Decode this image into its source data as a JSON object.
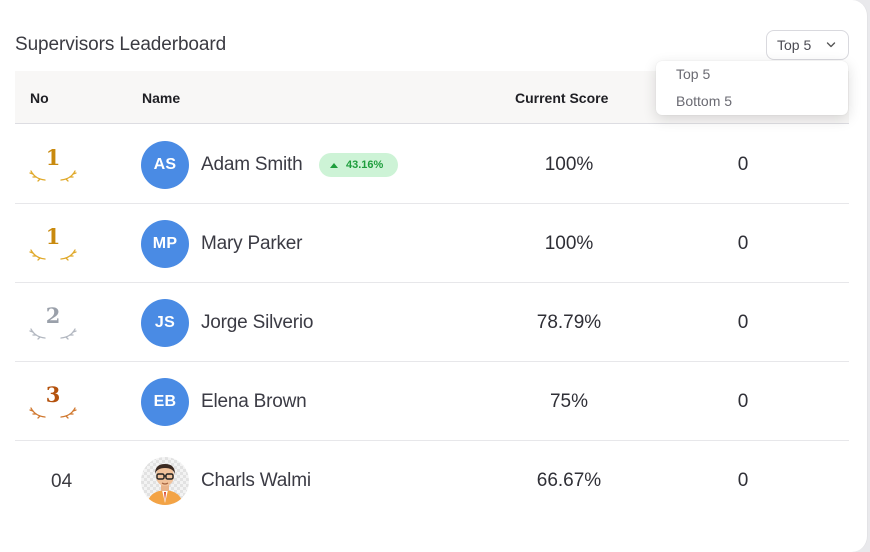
{
  "title": "Supervisors Leaderboard",
  "filter": {
    "selected": "Top 5",
    "options": [
      "Top 5",
      "Bottom 5"
    ]
  },
  "columns": {
    "no": "No",
    "name": "Name",
    "current_score": "Current Score"
  },
  "colors": {
    "gold": "#c98a0e",
    "silver": "#9aa0aa",
    "bronze": "#b4520d",
    "avatar": "#4a8be4",
    "badge_bg": "#cdf3d6",
    "badge_text": "#1f9e3d"
  },
  "rows": [
    {
      "rank": "1",
      "rank_style": "gold",
      "initials": "AS",
      "name": "Adam Smith",
      "badge": "43.16%",
      "score": "100%",
      "extra": "0"
    },
    {
      "rank": "1",
      "rank_style": "gold",
      "initials": "MP",
      "name": "Mary Parker",
      "score": "100%",
      "extra": "0"
    },
    {
      "rank": "2",
      "rank_style": "silver",
      "initials": "JS",
      "name": "Jorge Silverio",
      "score": "78.79%",
      "extra": "0"
    },
    {
      "rank": "3",
      "rank_style": "bronze",
      "initials": "EB",
      "name": "Elena Brown",
      "score": "75%",
      "extra": "0"
    },
    {
      "rank": "04",
      "rank_style": "plain",
      "avatar_icon": "person-photo-icon",
      "name": "Charls Walmi",
      "score": "66.67%",
      "extra": "0"
    }
  ]
}
